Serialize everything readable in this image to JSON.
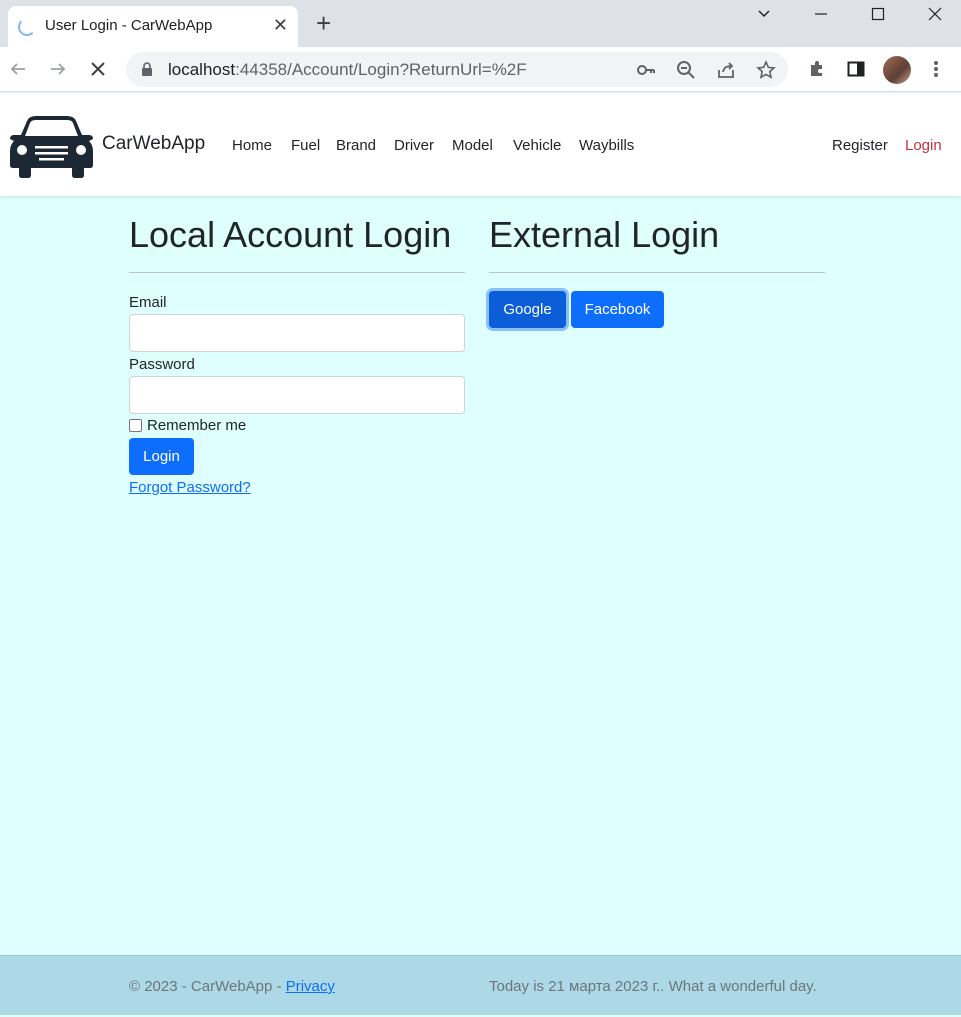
{
  "browser": {
    "tab_title": "User Login - CarWebApp",
    "url_host": "localhost",
    "url_rest": ":44358/Account/Login?ReturnUrl=%2F"
  },
  "navbar": {
    "brand": "CarWebApp",
    "items": [
      {
        "label": "Home"
      },
      {
        "label": "Fuel"
      },
      {
        "label": "Brand"
      },
      {
        "label": "Driver"
      },
      {
        "label": "Model"
      },
      {
        "label": "Vehicle"
      },
      {
        "label": "Waybills"
      }
    ],
    "register_label": "Register",
    "login_label": "Login"
  },
  "local_login": {
    "heading": "Local Account Login",
    "email_label": "Email",
    "email_value": "",
    "password_label": "Password",
    "password_value": "",
    "remember_label": "Remember me",
    "remember_checked": false,
    "submit_label": "Login",
    "forgot_label": "Forgot Password?"
  },
  "external_login": {
    "heading": "External Login",
    "providers": [
      "Google",
      "Facebook"
    ]
  },
  "footer": {
    "copyright": "© 2023 - CarWebApp - ",
    "privacy_label": "Privacy",
    "date_text": "Today is 21 марта 2023 г.. What a wonderful day."
  },
  "colors": {
    "page_bg": "#dfffff",
    "footer_bg": "#add8e6",
    "primary": "#0d6efd",
    "login_link": "#c0323c"
  }
}
